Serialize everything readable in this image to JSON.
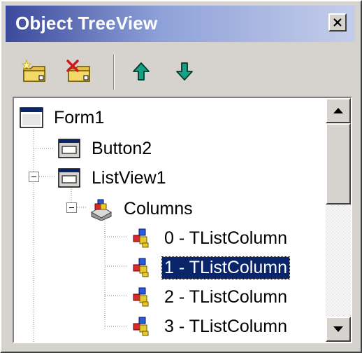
{
  "window": {
    "title": "Object TreeView",
    "close_icon": "close-icon"
  },
  "toolbar": {
    "buttons": [
      {
        "name": "new-item-button",
        "icon": "folder-new-icon"
      },
      {
        "name": "delete-item-button",
        "icon": "folder-delete-icon"
      },
      {
        "name": "move-up-button",
        "icon": "arrow-up-icon"
      },
      {
        "name": "move-down-button",
        "icon": "arrow-down-icon"
      }
    ]
  },
  "tree": {
    "nodes": [
      {
        "label": "Form1",
        "icon": "form-icon",
        "level": 0
      },
      {
        "label": "Button2",
        "icon": "component-icon",
        "level": 1
      },
      {
        "label": "ListView1",
        "icon": "component-icon",
        "level": 1,
        "expanded": true
      },
      {
        "label": "Columns",
        "icon": "collection-icon",
        "level": 2,
        "expanded": true
      },
      {
        "label": "0 - TListColumn",
        "icon": "list-column-icon",
        "level": 3
      },
      {
        "label": "1 - TListColumn",
        "icon": "list-column-icon",
        "level": 3,
        "selected": true
      },
      {
        "label": "2 - TListColumn",
        "icon": "list-column-icon",
        "level": 3
      },
      {
        "label": "3 - TListColumn",
        "icon": "list-column-icon",
        "level": 3
      }
    ]
  },
  "colors": {
    "title_gradient_start": "#3b4a9c",
    "title_gradient_end": "#c4cdea",
    "selection": "#0a246a",
    "arrow_green": "#16a085"
  }
}
